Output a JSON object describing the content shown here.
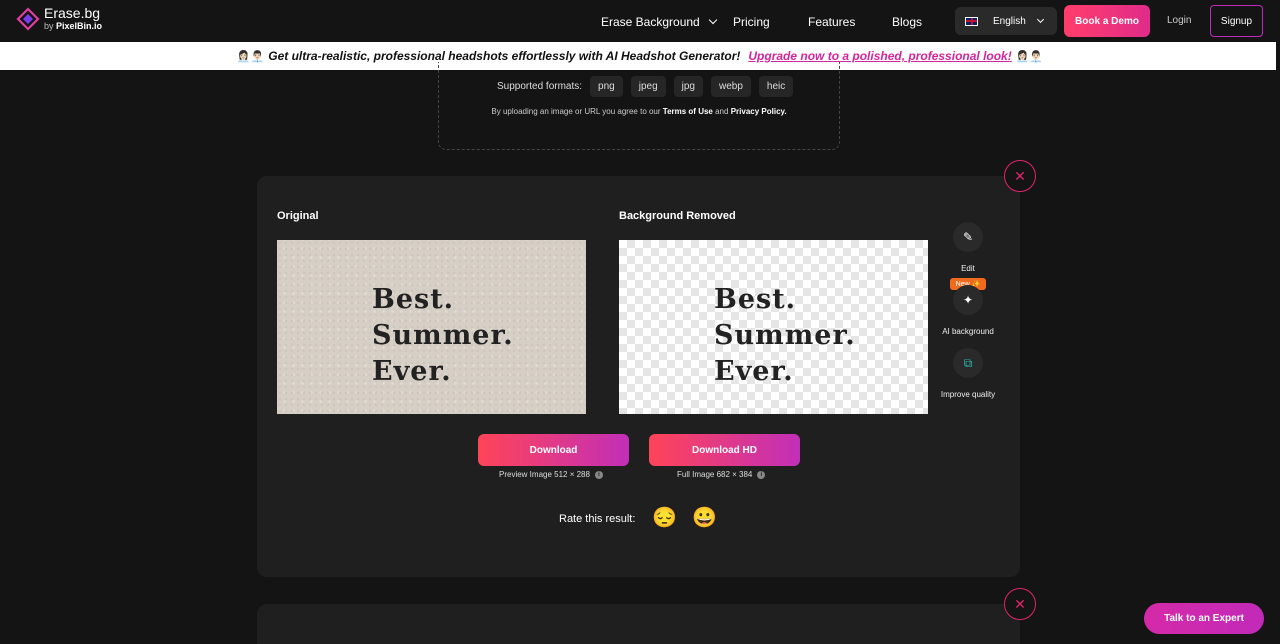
{
  "header": {
    "logo_title": "Erase.bg",
    "logo_by": "by",
    "logo_company": "PixelBin.io",
    "nav": {
      "erase_background": "Erase Background",
      "pricing": "Pricing",
      "features": "Features",
      "blogs": "Blogs"
    },
    "language": "English",
    "book_demo": "Book a Demo",
    "login": "Login",
    "signup": "Signup"
  },
  "promo": {
    "emoji": "👩🏻‍💼👨🏻‍💼",
    "text": "Get ultra-realistic, professional headshots effortlessly with AI Headshot Generator!",
    "link": "Upgrade now to a polished, professional look!"
  },
  "upload": {
    "formats_label": "Supported formats:",
    "formats": [
      "png",
      "jpeg",
      "jpg",
      "webp",
      "heic"
    ],
    "agree_prefix": "By uploading an image or URL you agree to our",
    "terms": "Terms of Use",
    "and": "and",
    "privacy": "Privacy Policy."
  },
  "result": {
    "original_title": "Original",
    "removed_title": "Background Removed",
    "image_text": [
      "Best.",
      "Summer.",
      "Ever."
    ],
    "tools": {
      "edit": "Edit",
      "ai_background": "AI background",
      "new_badge": "New ✨",
      "improve_quality": "Improve quality"
    },
    "download": "Download",
    "download_hd": "Download HD",
    "preview_info": "Preview Image 512 × 288",
    "full_info": "Full Image 682 × 384",
    "rate_label": "Rate this result:",
    "rate_bad": "😔",
    "rate_good": "😀"
  },
  "talk_expert": "Talk to an Expert",
  "colors": {
    "accent": "#e0246c",
    "gradient_start": "#ff4458",
    "gradient_end": "#c22fb8",
    "background": "#141414",
    "card": "#1f1f1f"
  }
}
